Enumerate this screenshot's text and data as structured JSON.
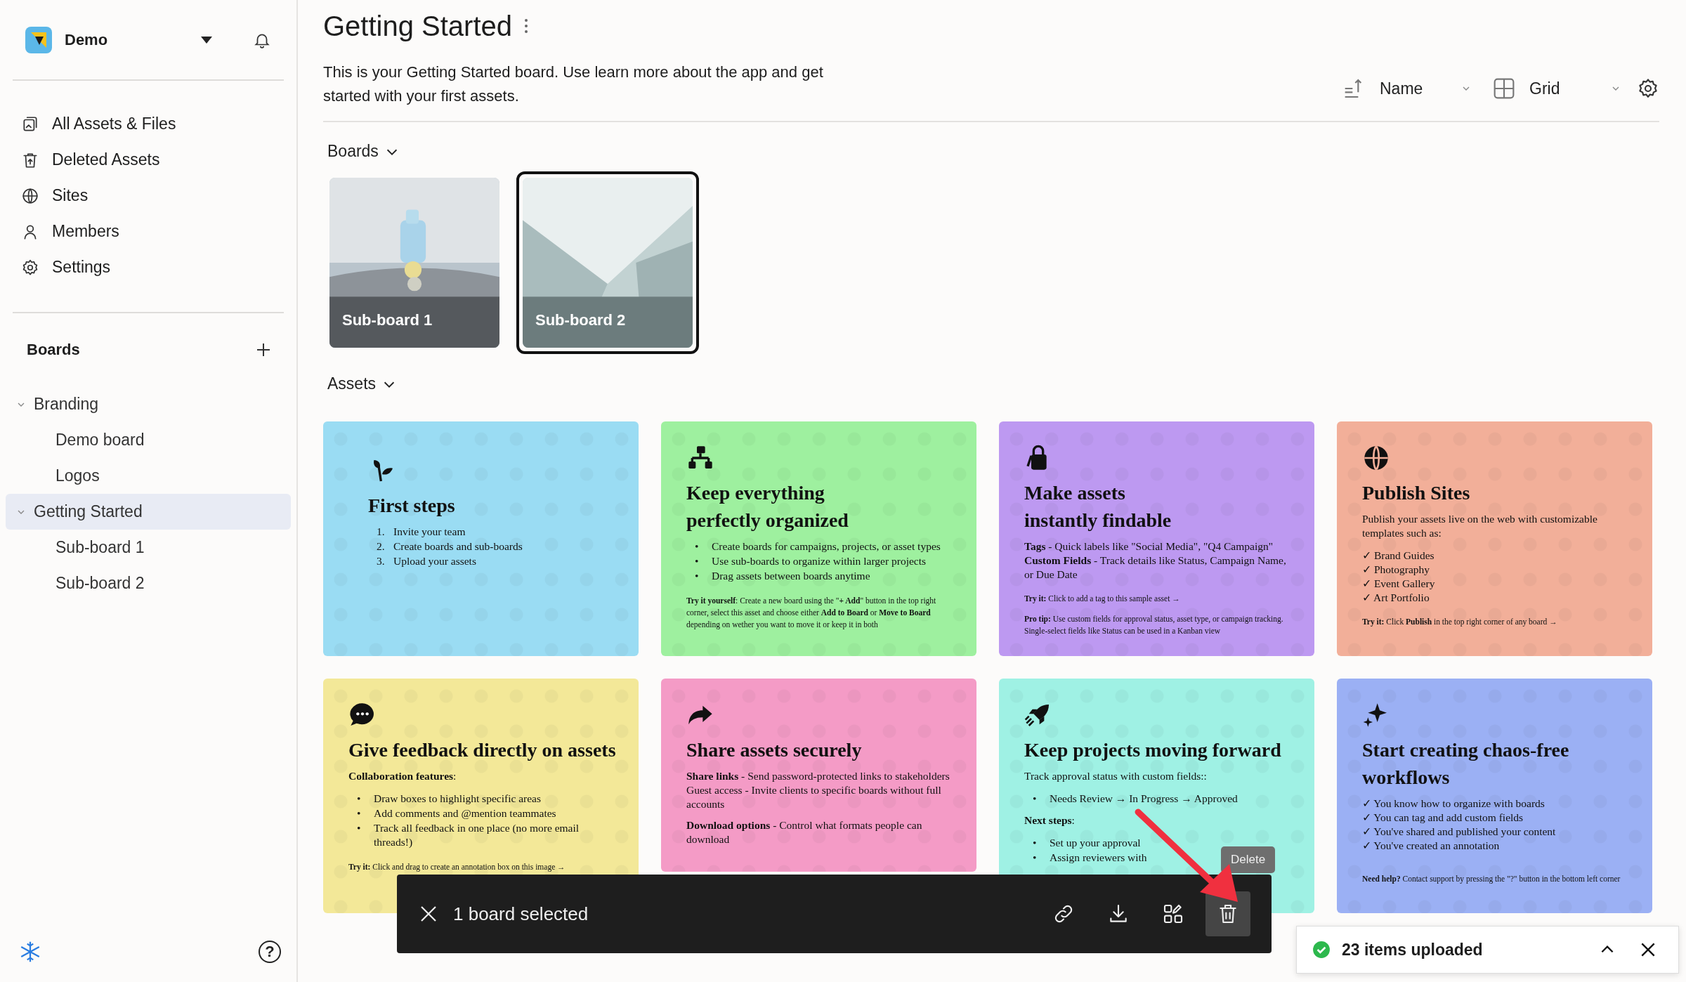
{
  "workspace": {
    "name": "Demo"
  },
  "nav": [
    {
      "kind": "files",
      "label": "All Assets & Files"
    },
    {
      "kind": "trash",
      "label": "Deleted Assets"
    },
    {
      "kind": "globe",
      "label": "Sites"
    },
    {
      "kind": "person",
      "label": "Members"
    },
    {
      "kind": "gear",
      "label": "Settings"
    }
  ],
  "boards_heading": "Boards",
  "tree": [
    {
      "label": "Branding",
      "expanded": true,
      "selected": false,
      "children": [
        {
          "label": "Demo board",
          "selected": false
        },
        {
          "label": "Logos",
          "selected": false
        }
      ]
    },
    {
      "label": "Getting Started",
      "expanded": true,
      "selected": true,
      "children": [
        {
          "label": "Sub-board 1",
          "selected": false
        },
        {
          "label": "Sub-board 2",
          "selected": false
        }
      ]
    }
  ],
  "help": "?",
  "page": {
    "title": "Getting Started",
    "description": "This is your Getting Started board. Use learn more about the app and get started with your first assets.",
    "sort": "Name",
    "view": "Grid"
  },
  "sections": {
    "boards": "Boards",
    "assets": "Assets"
  },
  "boards": [
    {
      "label": "Sub-board 1",
      "selected": false
    },
    {
      "label": "Sub-board 2",
      "selected": true
    }
  ],
  "assets": [
    {
      "kind": "sprout",
      "color": "#9adcf3",
      "title": "First steps",
      "blocks": [
        {
          "kind": "list",
          "items": [
            {
              "marker": "1.",
              "text": "Invite your team"
            },
            {
              "marker": "2.",
              "text": "Create boards and sub-boards"
            },
            {
              "marker": "3.",
              "text": "Upload your assets"
            }
          ]
        }
      ]
    },
    {
      "kind": "sitemap",
      "color": "#9ef09f",
      "title": "Keep everything\nperfectly organized",
      "blocks": [
        {
          "kind": "list",
          "items": [
            {
              "marker": "•",
              "text": "Create boards for campaigns, projects, or asset types"
            },
            {
              "marker": "•",
              "text": "Use sub-boards to organize within larger projects"
            },
            {
              "marker": "•",
              "text": "Drag assets between boards anytime"
            }
          ]
        },
        {
          "kind": "small",
          "text": "**Try it yourself**: Create a new board using the \"**+ Add**\" button in the top right corner, select this asset and choose either **Add to Board** or **Move to Board** depending on wether you want to move it or keep it in both"
        }
      ]
    },
    {
      "kind": "bag",
      "color": "#bd99f1",
      "title": "Make assets\ninstantly findable",
      "blocks": [
        {
          "kind": "lines",
          "items": [
            "**Tags** - Quick labels like \"Social Media\", \"Q4 Campaign\"",
            "**Custom Fields** - Track details like Status, Campaign Name, or Due Date"
          ]
        },
        {
          "kind": "small",
          "text": "**Try it:** Click to add a tag to this sample asset →"
        },
        {
          "kind": "small",
          "text": "**Pro tip:** Use custom fields for approval status, asset type, or campaign tracking. Single-select fields like Status can be used in a Kanban view"
        }
      ]
    },
    {
      "kind": "globe",
      "color": "#f2af99",
      "title": "Publish Sites",
      "blocks": [
        {
          "kind": "p",
          "text": "Publish your assets live on the web with customizable templates such as:"
        },
        {
          "kind": "lines",
          "items": [
            "✓ Brand Guides",
            "✓ Photography",
            "✓ Event Gallery",
            "✓ Art Portfolio"
          ]
        },
        {
          "kind": "small",
          "text": "**Try it:** Click **Publish** in the top right corner of any board →"
        }
      ]
    },
    {
      "kind": "chat",
      "color": "#f3e898",
      "title": "Give feedback directly on assets",
      "blocks": [
        {
          "kind": "p",
          "text": "**Collaboration features**:"
        },
        {
          "kind": "list",
          "items": [
            {
              "marker": "•",
              "text": "Draw boxes to highlight specific areas"
            },
            {
              "marker": "•",
              "text": "Add comments and @mention teammates"
            },
            {
              "marker": "•",
              "text": "Track all feedback in one place (no more email threads!)"
            }
          ]
        },
        {
          "kind": "small",
          "text": "**Try it:** Click and drag to create an annotation box on this image →"
        }
      ]
    },
    {
      "kind": "share",
      "color": "#f49bc6",
      "title": "Share assets securely",
      "blocks": [
        {
          "kind": "lines",
          "items": [
            "**Share links** - Send password-protected links to stakeholders",
            "Guest access - Invite clients to specific boards without full accounts"
          ]
        },
        {
          "kind": "p",
          "text": "**Download options** - Control what formats people can download"
        }
      ]
    },
    {
      "kind": "rocket",
      "color": "#9ff1e4",
      "title": "Keep projects moving forward",
      "blocks": [
        {
          "kind": "p",
          "text": "Track approval status with custom fields::"
        },
        {
          "kind": "list",
          "items": [
            {
              "marker": "•",
              "text": "Needs Review → In Progress → Approved"
            }
          ]
        },
        {
          "kind": "p",
          "text": "**Next steps**:"
        },
        {
          "kind": "list",
          "items": [
            {
              "marker": "•",
              "text": "Set up your approval"
            },
            {
              "marker": "•",
              "text": "Assign reviewers with"
            }
          ]
        }
      ]
    },
    {
      "kind": "sparkle",
      "color": "#9bb0f4",
      "title": "Start creating chaos-free\nworkflows",
      "blocks": [
        {
          "kind": "lines",
          "items": [
            "✓ You know how to organize with boards",
            "✓ You can tag and add custom fields",
            "✓ You've shared and published your content",
            "✓ You've created an annotation"
          ]
        },
        {
          "kind": "foot",
          "text": "**Need help?** Contact support by pressing the \"?\" button in the bottom left corner"
        }
      ]
    }
  ],
  "selection_bar": {
    "label": "1 board selected",
    "actions": [
      {
        "kind": "link",
        "selected": false
      },
      {
        "kind": "download",
        "selected": false
      },
      {
        "kind": "move",
        "selected": false
      },
      {
        "kind": "delete",
        "selected": true
      }
    ],
    "tooltip": "Delete"
  },
  "toast": {
    "label": "23 items uploaded"
  }
}
